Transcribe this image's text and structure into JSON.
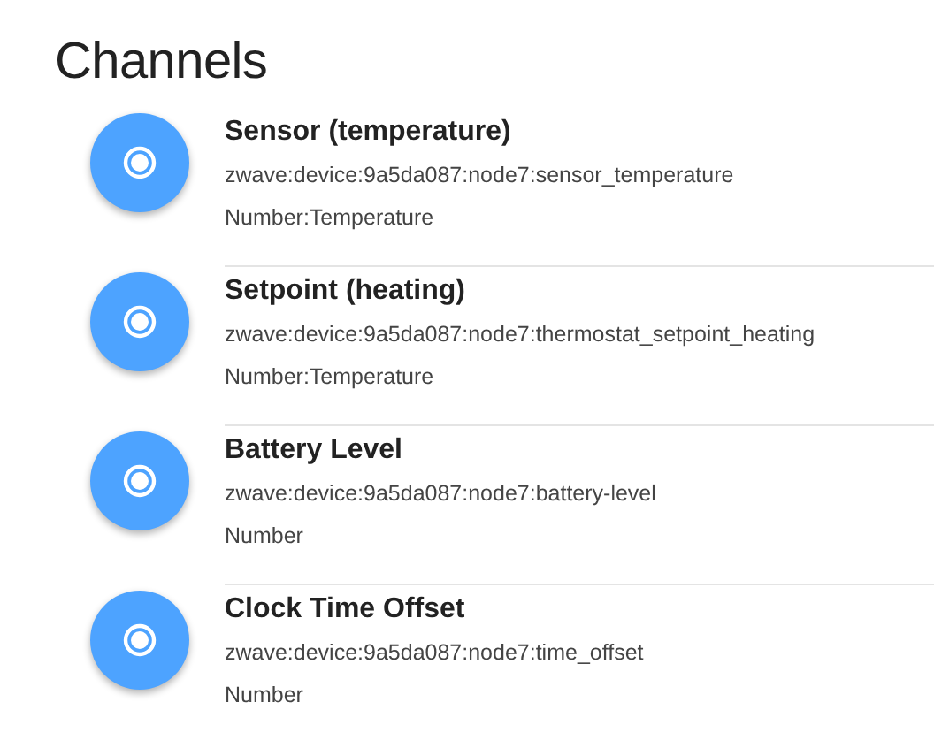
{
  "heading": "Channels",
  "channels": [
    {
      "label": "Sensor (temperature)",
      "uid": "zwave:device:9a5da087:node7:sensor_temperature",
      "item_type": "Number:Temperature"
    },
    {
      "label": "Setpoint (heating)",
      "uid": "zwave:device:9a5da087:node7:thermostat_setpoint_heating",
      "item_type": "Number:Temperature"
    },
    {
      "label": "Battery Level",
      "uid": "zwave:device:9a5da087:node7:battery-level",
      "item_type": "Number"
    },
    {
      "label": "Clock Time Offset",
      "uid": "zwave:device:9a5da087:node7:time_offset",
      "item_type": "Number"
    }
  ]
}
